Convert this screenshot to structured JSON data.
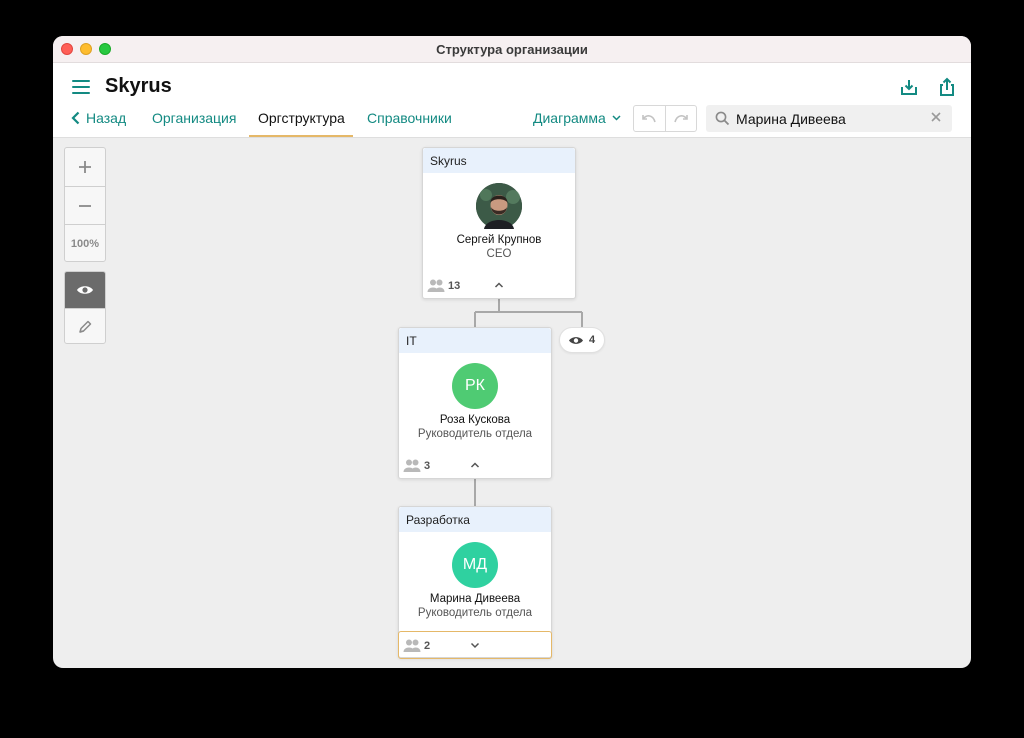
{
  "window": {
    "title": "Структура организации"
  },
  "header": {
    "app_title": "Skyrus",
    "icons": [
      "menu-icon",
      "download-icon",
      "share-icon"
    ]
  },
  "nav": {
    "back_label": "Назад",
    "tabs": [
      {
        "label": "Организация",
        "active": false
      },
      {
        "label": "Оргструктура",
        "active": true
      },
      {
        "label": "Справочники",
        "active": false
      }
    ],
    "view_select": "Диаграмма",
    "undo_icon": "undo-icon",
    "redo_icon": "redo-icon"
  },
  "search": {
    "value": "Марина Дивеева",
    "placeholder": ""
  },
  "zoom": {
    "plus": "+",
    "minus": "−",
    "level": "100%"
  },
  "modes": [
    "eye-icon",
    "pencil-icon"
  ],
  "cards": [
    {
      "department": "Skyrus",
      "name": "Сергей Крупнов",
      "role": "CEO",
      "initials": "",
      "avatar_type": "photo",
      "count": "13",
      "expanded": true
    },
    {
      "department": "IT",
      "name": "Роза Кускова",
      "role": "Руководитель отдела",
      "initials": "РК",
      "avatar_color": "#4fcb73",
      "count": "3",
      "expanded": true
    },
    {
      "department": "Разработка",
      "name": "Марина Дивеева",
      "role": "Руководитель отдела",
      "initials": "МД",
      "avatar_color": "#2fd1a0",
      "count": "2",
      "expanded": false
    }
  ],
  "viewers_badge": {
    "count": "4"
  },
  "colors": {
    "accent": "#138a82",
    "tab_underline": "#e5b868",
    "card_header": "#e8f1fc"
  }
}
